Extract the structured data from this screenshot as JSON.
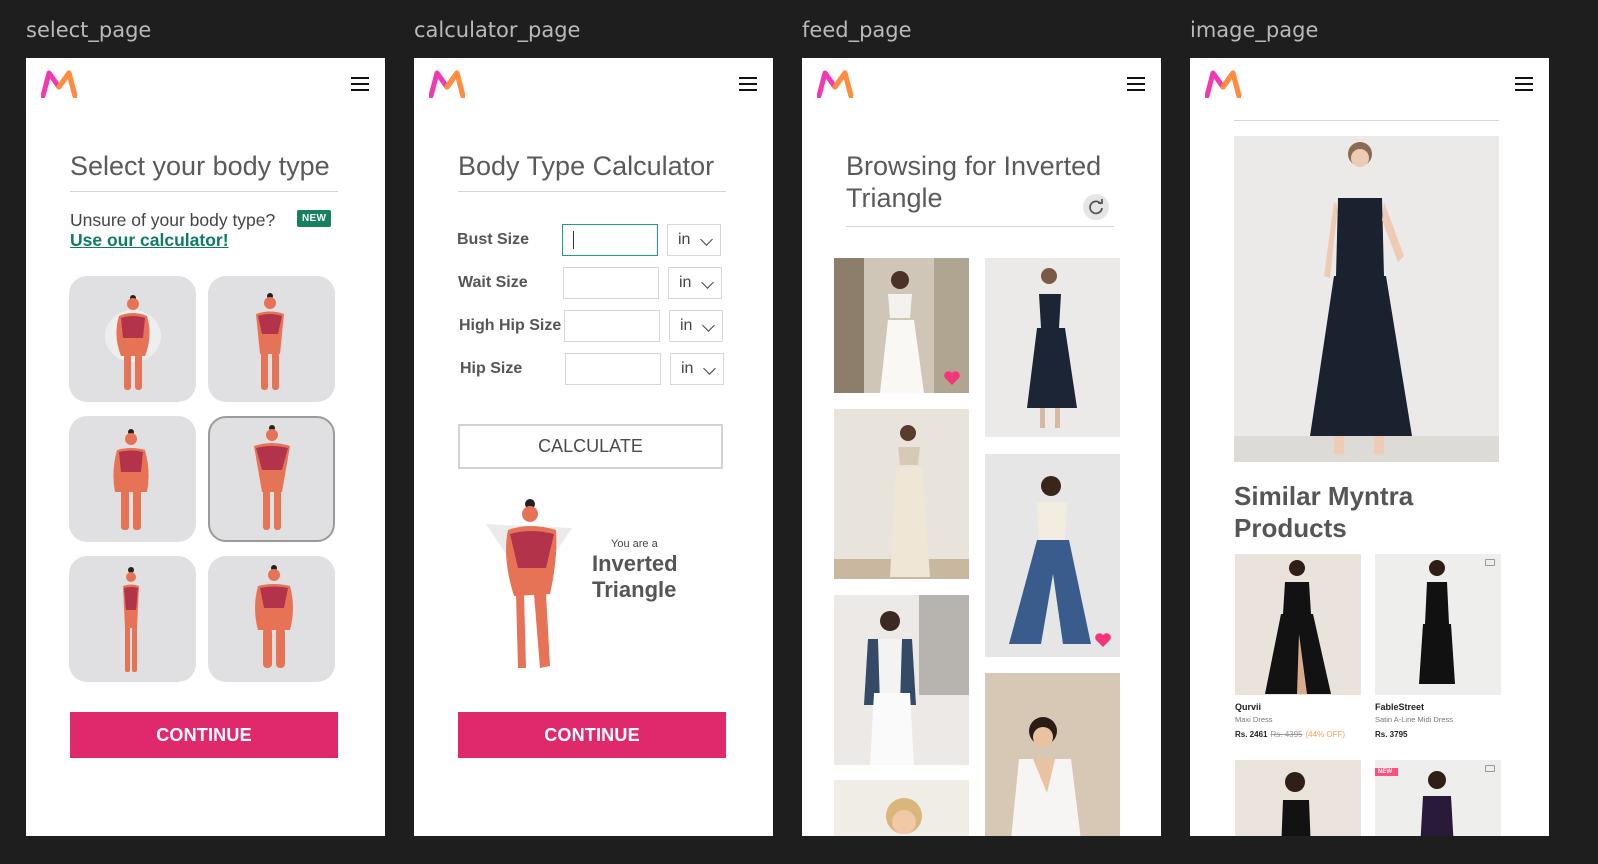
{
  "frames": {
    "select": {
      "label": "select_page"
    },
    "calculator": {
      "label": "calculator_page"
    },
    "feed": {
      "label": "feed_page"
    },
    "image": {
      "label": "image_page"
    }
  },
  "brand": {
    "accent": "#e0296d",
    "link": "#0f7a66",
    "badge": "#17805f"
  },
  "select_page": {
    "title": "Select your body type",
    "unsure_text": "Unsure of your body type?",
    "new_badge": "NEW",
    "calculator_link": "Use our calculator!",
    "continue_label": "CONTINUE"
  },
  "calculator_page": {
    "title": "Body Type Calculator",
    "fields": [
      {
        "label": "Bust Size",
        "value": "",
        "unit": "in"
      },
      {
        "label": "Wait Size",
        "value": "",
        "unit": "in"
      },
      {
        "label": "High Hip Size",
        "value": "",
        "unit": "in"
      },
      {
        "label": "Hip Size",
        "value": "",
        "unit": "in"
      }
    ],
    "calculate_label": "CALCULATE",
    "result_prefix": "You are a",
    "result_line1": "Inverted",
    "result_line2": "Triangle",
    "continue_label": "CONTINUE"
  },
  "feed_page": {
    "title_line1": "Browsing for Inverted",
    "title_line2": "Triangle"
  },
  "image_page": {
    "similar_line1": "Similar Myntra",
    "similar_line2": "Products",
    "products": [
      {
        "brand": "Qurvii",
        "name": "Maxi Dress",
        "price": "Rs. 2461",
        "old_price": "Rs. 4395",
        "discount": "(44% OFF)"
      },
      {
        "brand": "FableStreet",
        "name": "Satin A-Line Midi Dress",
        "price": "Rs. 3795"
      }
    ],
    "new_tag": "NEW"
  }
}
